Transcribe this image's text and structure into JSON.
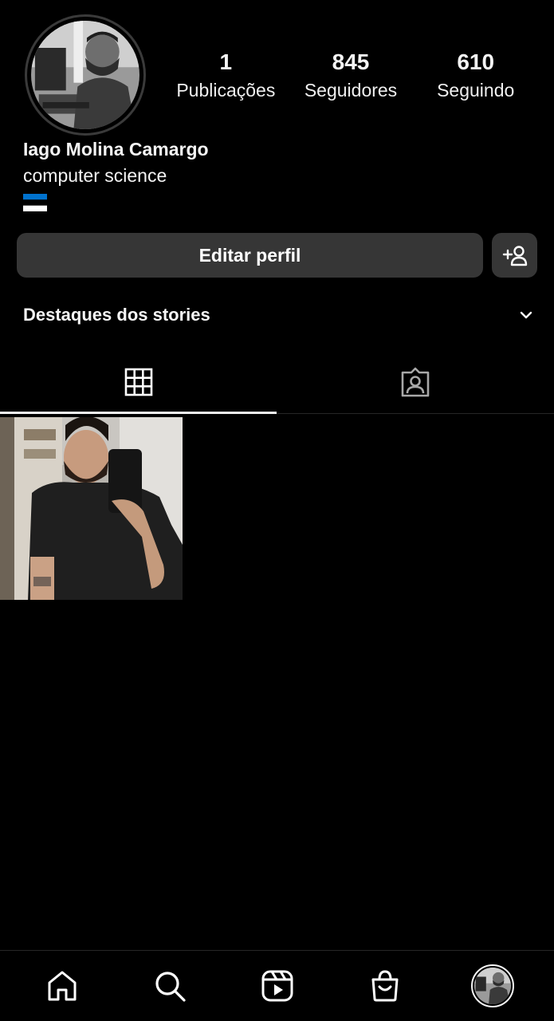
{
  "profile": {
    "name": "Iago Molina Camargo",
    "bio": "computer science",
    "flag_icon": "estonia-flag-icon",
    "flag_colors": [
      "#0072CE",
      "#000000",
      "#FFFFFF"
    ],
    "stats": [
      {
        "count": "1",
        "label": "Publicações"
      },
      {
        "count": "845",
        "label": "Seguidores"
      },
      {
        "count": "610",
        "label": "Seguindo"
      }
    ]
  },
  "actions": {
    "edit_label": "Editar perfil",
    "add_person_icon": "add-person-icon"
  },
  "highlights": {
    "title": "Destaques dos stories",
    "toggle_icon": "chevron-down-icon"
  },
  "tabs": [
    {
      "icon": "grid-icon",
      "active": true
    },
    {
      "icon": "tagged-person-icon",
      "active": false
    }
  ],
  "posts": [
    {
      "icon": "mirror-selfie-photo"
    }
  ],
  "nav": [
    {
      "icon": "home-icon"
    },
    {
      "icon": "search-icon"
    },
    {
      "icon": "reels-icon"
    },
    {
      "icon": "shop-icon"
    },
    {
      "icon": "profile-avatar"
    }
  ],
  "colors": {
    "background": "#000000",
    "button": "#363636",
    "text": "#f5f5f5",
    "divider": "#262626"
  }
}
